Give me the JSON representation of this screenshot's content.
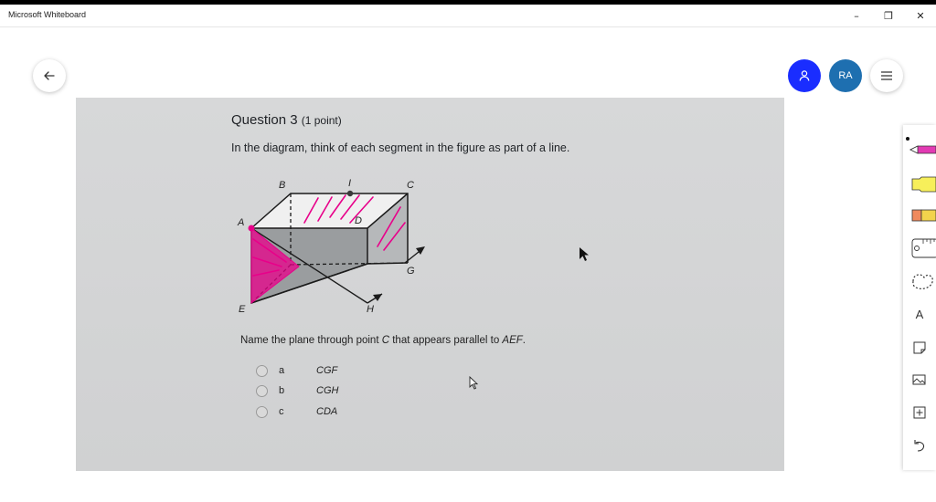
{
  "window": {
    "title": "Microsoft Whiteboard",
    "minimize_glyph": "–",
    "restore_glyph": "❐",
    "close_glyph": "✕"
  },
  "header": {
    "back_icon": "arrow-left-icon",
    "person_icon": "person-icon",
    "avatar_initials": "RA",
    "menu_icon": "hamburger-menu-icon",
    "colors": {
      "person_button": "#1a2dff",
      "avatar": "#1e6fb0"
    }
  },
  "question": {
    "title": "Question 3",
    "points": "(1 point)",
    "text": "In the diagram, think of each segment in the figure as part of a line.",
    "prompt_before": "Name the plane through point ",
    "prompt_point": "C",
    "prompt_middle": " that appears parallel to ",
    "prompt_plane": "AEF",
    "prompt_end": ".",
    "options": [
      {
        "letter": "a",
        "text": "CGF"
      },
      {
        "letter": "b",
        "text": "CGH"
      },
      {
        "letter": "c",
        "text": "CDA"
      }
    ]
  },
  "figure": {
    "labels": {
      "A": "A",
      "B": "B",
      "C": "C",
      "D": "D",
      "E": "E",
      "G": "G",
      "H": "H",
      "I": "I"
    },
    "annotation_color": "#e8008a"
  },
  "toolbar": {
    "items": [
      {
        "name": "pen-icon"
      },
      {
        "name": "highlighter-icon"
      },
      {
        "name": "eraser-icon"
      },
      {
        "name": "ruler-icon"
      },
      {
        "name": "lasso-icon"
      },
      {
        "name": "text-icon",
        "label": "A"
      },
      {
        "name": "sticky-note-icon"
      },
      {
        "name": "image-icon"
      },
      {
        "name": "add-icon"
      },
      {
        "name": "undo-icon"
      }
    ]
  }
}
